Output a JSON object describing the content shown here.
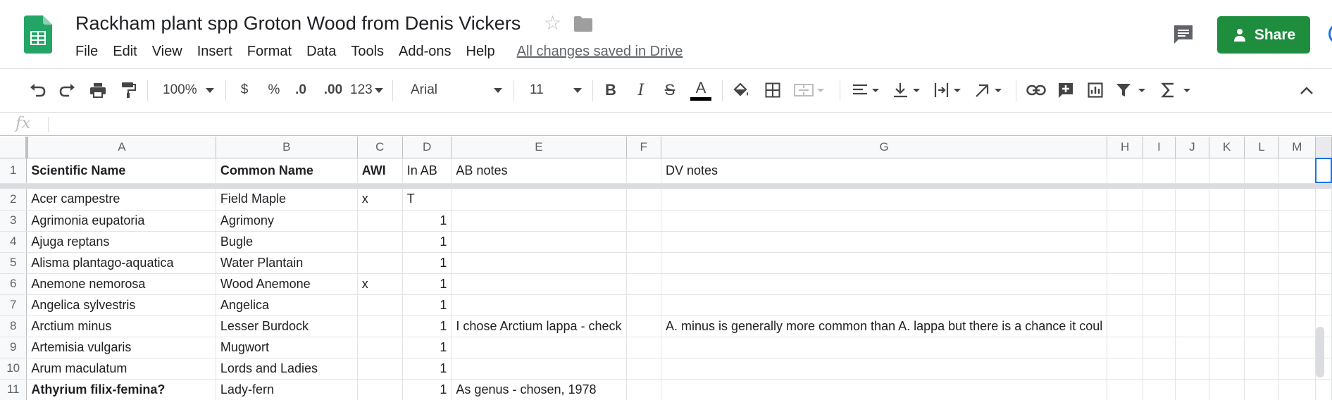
{
  "document": {
    "title": "Rackham plant spp Groton Wood from Denis Vickers",
    "saved_status": "All changes saved in Drive",
    "share_label": "Share"
  },
  "menu": [
    "File",
    "Edit",
    "View",
    "Insert",
    "Format",
    "Data",
    "Tools",
    "Add-ons",
    "Help"
  ],
  "toolbar": {
    "zoom": "100%",
    "currency": "$",
    "percent": "%",
    "decrease_decimals": ".0",
    "increase_decimals": ".00",
    "more_formats": "123",
    "font": "Arial",
    "font_size": "11",
    "bold": "B",
    "italic": "I",
    "strikethrough": "S",
    "text_color": "A"
  },
  "formula_bar": {
    "label": "fx",
    "value": ""
  },
  "columns": [
    "A",
    "B",
    "C",
    "D",
    "E",
    "F",
    "G",
    "H",
    "I",
    "J",
    "K",
    "L",
    "M"
  ],
  "rows": [
    {
      "num": "1",
      "cells": [
        "Scientific Name",
        "Common Name",
        "AWI",
        "In AB",
        "AB notes",
        "",
        "DV notes",
        "",
        "",
        "",
        "",
        "",
        ""
      ]
    },
    {
      "num": "2",
      "cells": [
        "Acer campestre",
        "Field Maple",
        "x",
        "T",
        "",
        "",
        "",
        "",
        "",
        "",
        "",
        "",
        ""
      ]
    },
    {
      "num": "3",
      "cells": [
        "Agrimonia eupatoria",
        "Agrimony",
        "",
        "1",
        "",
        "",
        "",
        "",
        "",
        "",
        "",
        "",
        ""
      ]
    },
    {
      "num": "4",
      "cells": [
        "Ajuga reptans",
        "Bugle",
        "",
        "1",
        "",
        "",
        "",
        "",
        "",
        "",
        "",
        "",
        ""
      ]
    },
    {
      "num": "5",
      "cells": [
        "Alisma plantago-aquatica",
        "Water  Plantain",
        "",
        "1",
        "",
        "",
        "",
        "",
        "",
        "",
        "",
        "",
        ""
      ]
    },
    {
      "num": "6",
      "cells": [
        "Anemone nemorosa",
        "Wood Anemone",
        "x",
        "1",
        "",
        "",
        "",
        "",
        "",
        "",
        "",
        "",
        ""
      ]
    },
    {
      "num": "7",
      "cells": [
        "Angelica sylvestris",
        "Angelica",
        "",
        "1",
        "",
        "",
        "",
        "",
        "",
        "",
        "",
        "",
        ""
      ]
    },
    {
      "num": "8",
      "cells": [
        "Arctium minus",
        "Lesser Burdock",
        "",
        "1",
        "I chose Arctium lappa - check",
        "",
        "A. minus is generally more common than A. lappa but there is a chance it coul",
        "",
        "",
        "",
        "",
        "",
        ""
      ]
    },
    {
      "num": "9",
      "cells": [
        "Artemisia vulgaris",
        "Mugwort",
        "",
        "1",
        "",
        "",
        "",
        "",
        "",
        "",
        "",
        "",
        ""
      ]
    },
    {
      "num": "10",
      "cells": [
        "Arum maculatum",
        "Lords and Ladies",
        "",
        "1",
        "",
        "",
        "",
        "",
        "",
        "",
        "",
        "",
        ""
      ]
    },
    {
      "num": "11",
      "cells": [
        "Athyrium filix-femina?",
        "Lady-fern",
        "",
        "1",
        "As genus - chosen, 1978",
        "",
        "",
        "",
        "",
        "",
        "",
        "",
        ""
      ]
    }
  ],
  "colors": {
    "share_green": "#1e8e3e",
    "sheets_green": "#23a566",
    "selection_blue": "#1a73e8"
  }
}
